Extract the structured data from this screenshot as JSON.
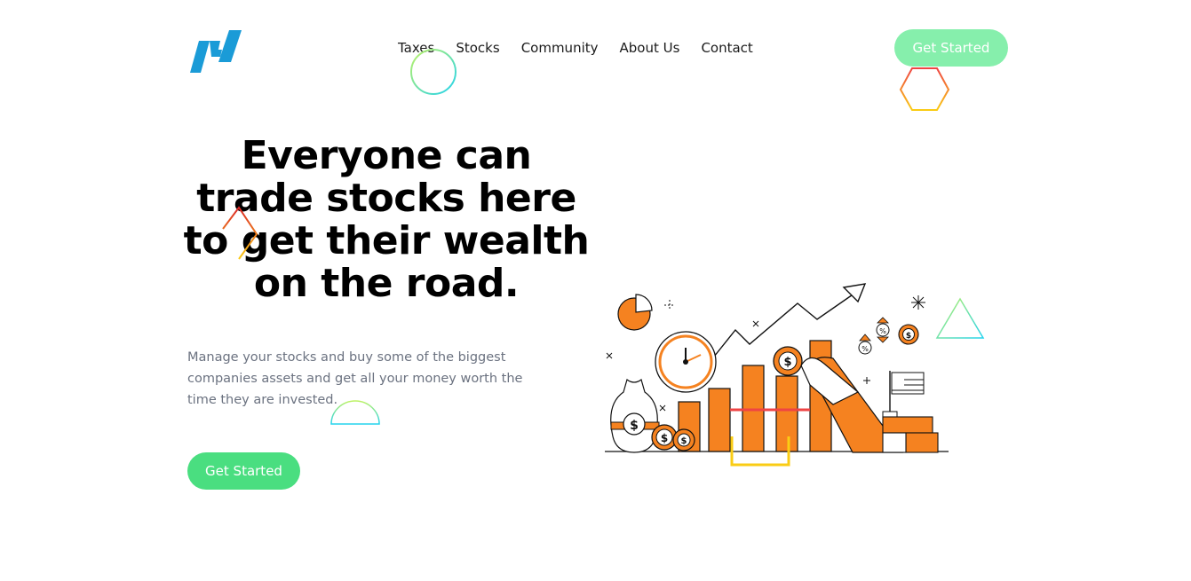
{
  "nav": {
    "items": [
      {
        "label": "Taxes"
      },
      {
        "label": "Stocks"
      },
      {
        "label": "Community"
      },
      {
        "label": "About Us"
      },
      {
        "label": "Contact"
      }
    ],
    "cta_label": "Get Started"
  },
  "hero": {
    "title": "Everyone can trade stocks here to get their wealth on the road.",
    "subtitle": "Manage your stocks and buy some of the biggest companies assets and get all your money worth the time they are invested.",
    "cta_label": "Get Started"
  },
  "illustration": {
    "coin_symbol": "$",
    "percent_symbol": "%"
  },
  "colors": {
    "brand_blue": "#1a9bd7",
    "cta_light": "#86efac",
    "cta_green": "#4ade80",
    "accent_orange": "#f58220",
    "text_muted": "#6b7280"
  }
}
